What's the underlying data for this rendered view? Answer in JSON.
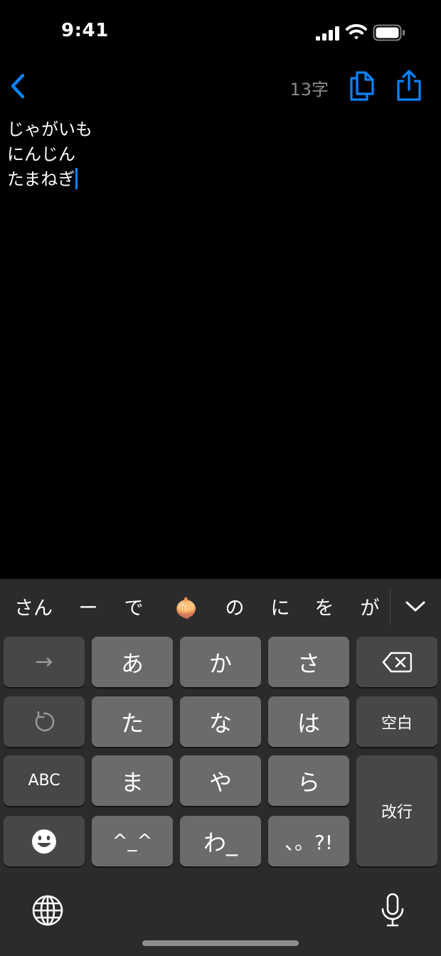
{
  "status_bar": {
    "time": "9:41"
  },
  "nav": {
    "char_count": "13字",
    "back_icon": "chevron-left-icon",
    "copy_icon": "copy-document-icon",
    "share_icon": "share-icon",
    "accent_color": "#0a84ff"
  },
  "editor": {
    "lines": [
      "じゃがいも",
      "にんじん",
      "たまねぎ"
    ]
  },
  "keyboard": {
    "suggestions": [
      "さん",
      "ー",
      "で",
      "🧅",
      "の",
      "に",
      "を",
      "が"
    ],
    "keys": {
      "next_arrow": "→",
      "a": "あ",
      "ka": "か",
      "sa": "さ",
      "ta": "た",
      "na": "な",
      "ha": "は",
      "space": "空白",
      "abc": "ABC",
      "ma": "ま",
      "ya": "や",
      "ra": "ら",
      "enter": "改行",
      "kaomoji": "^_^",
      "wa": "わ_",
      "punct": "、。?!"
    }
  }
}
